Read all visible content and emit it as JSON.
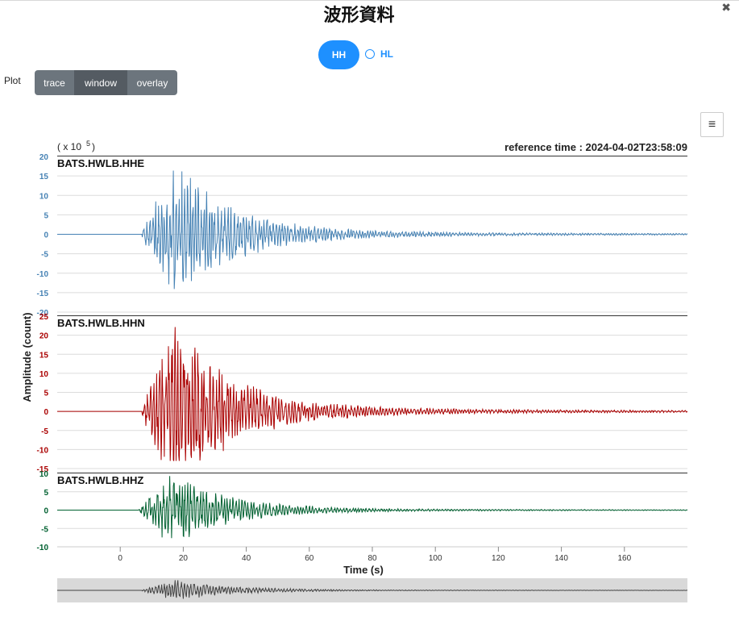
{
  "page": {
    "title": "波形資料",
    "close_icon": "close-icon"
  },
  "network": {
    "options": [
      "HH",
      "HL"
    ],
    "selected": "HH"
  },
  "plot_control": {
    "label": "Plot",
    "options": [
      "trace",
      "window",
      "overlay"
    ],
    "selected": "window"
  },
  "export_menu": {
    "icon": "hamburger-menu-icon",
    "glyph": "≡"
  },
  "chart_data": {
    "type": "line",
    "scale_note": {
      "prefix": "( x 10",
      "exponent": "5",
      "suffix": ")"
    },
    "reference_time": "reference time : 2024-04-02T23:58:09",
    "xlabel": "Time (s)",
    "ylabel": "Amplitude (count)",
    "x_ticks": [
      "0",
      "20",
      "40",
      "60",
      "80",
      "100",
      "120",
      "140",
      "160"
    ],
    "xlim": [
      -20,
      180
    ],
    "grid": true,
    "series": [
      {
        "name": "BATS.HWLB.HHE",
        "color": "#4682b4",
        "ylim": [
          -20,
          20
        ],
        "y_ticks": [
          "20",
          "15",
          "10",
          "5",
          "0",
          "-5",
          "-10",
          "-15",
          "-20"
        ],
        "peak_positive": 18,
        "peak_negative": -18,
        "onset_s": 7
      },
      {
        "name": "BATS.HWLB.HHN",
        "color": "#aa0000",
        "ylim": [
          -15,
          25
        ],
        "y_ticks": [
          "25",
          "20",
          "15",
          "10",
          "5",
          "0",
          "-5",
          "-10",
          "-15"
        ],
        "peak_positive": 23,
        "peak_negative": -13,
        "onset_s": 7
      },
      {
        "name": "BATS.HWLB.HHZ",
        "color": "#006030",
        "ylim": [
          -10,
          10
        ],
        "y_ticks": [
          "10",
          "5",
          "0",
          "-5",
          "-10"
        ],
        "peak_positive": 9.5,
        "peak_negative": -8.5,
        "onset_s": 6
      }
    ],
    "navigator": {
      "color": "#444444"
    }
  }
}
